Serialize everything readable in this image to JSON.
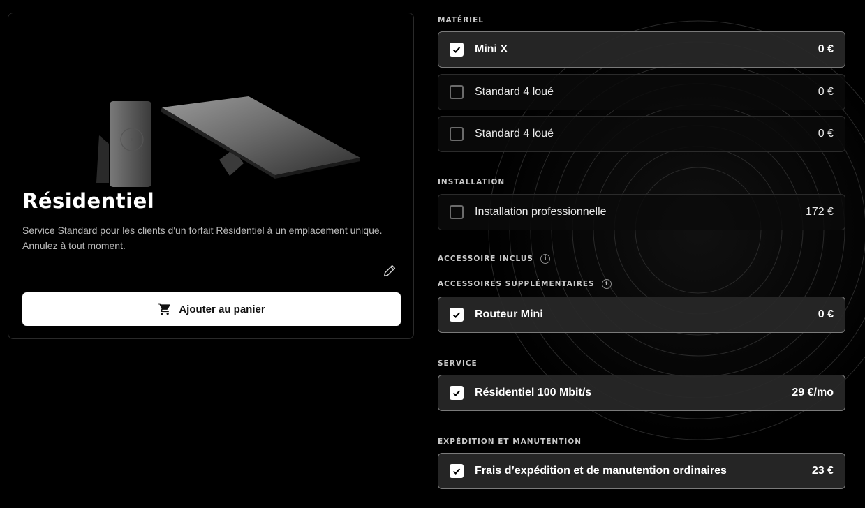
{
  "product": {
    "title": "Résidentiel",
    "description": "Service Standard pour les clients d'un forfait Résidentiel à un emplacement unique. Annulez à tout moment.",
    "cart_button": "Ajouter au panier"
  },
  "sections": {
    "hardware": {
      "label": "MATÉRIEL",
      "options": [
        {
          "label": "Mini X",
          "price": "0 €",
          "checked": true
        },
        {
          "label": "Standard 4 loué",
          "price": "0 €",
          "checked": false
        },
        {
          "label": "Standard 4 loué",
          "price": "0 €",
          "checked": false
        }
      ]
    },
    "installation": {
      "label": "INSTALLATION",
      "options": [
        {
          "label": "Installation professionnelle",
          "price": "172 €",
          "checked": false
        }
      ]
    },
    "included_accessory": {
      "label": "ACCESSOIRE INCLUS"
    },
    "extra_accessories": {
      "label": "ACCESSOIRES SUPPLÉMENTAIRES",
      "options": [
        {
          "label": "Routeur Mini",
          "price": "0 €",
          "checked": true
        }
      ]
    },
    "service": {
      "label": "SERVICE",
      "options": [
        {
          "label": "Résidentiel 100 Mbit/s",
          "price": "29 €/mo",
          "checked": true
        }
      ]
    },
    "shipping": {
      "label": "EXPÉDITION ET MANUTENTION",
      "options": [
        {
          "label": "Frais d’expédition et de manutention ordinaires",
          "price": "23 €",
          "checked": true
        }
      ]
    }
  },
  "icons": {
    "cart": "shopping-cart-icon",
    "edit": "pencil-icon",
    "info": "info-icon",
    "check": "check-icon"
  },
  "colors": {
    "background": "#000000",
    "selected_option_bg": "#282828",
    "button_bg": "#ffffff"
  }
}
